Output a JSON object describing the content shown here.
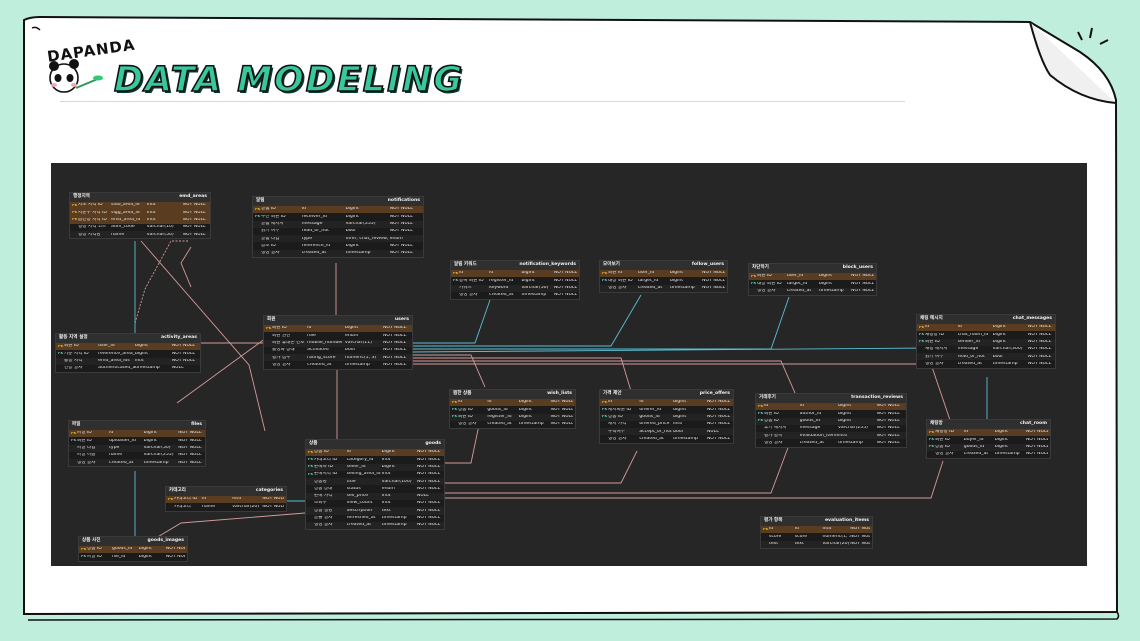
{
  "logo": {
    "text": "DAPANDA"
  },
  "title": "DATA MODELING",
  "erd": {
    "tables": [
      {
        "id": "emd_areas",
        "label": "행정지역",
        "name": "emd_areas",
        "rows": [
          [
            "PK",
            "시도 지역 ID",
            "sido_area_id",
            "int4",
            "NOT NULL"
          ],
          [
            "PK",
            "시군구 지역 ID",
            "sigg_area_id",
            "int4",
            "NOT NULL"
          ],
          [
            "PK",
            "읍면동 지역 ID",
            "emd_area_id",
            "int4",
            "NOT NULL"
          ],
          [
            "",
            "행정 지역 코드",
            "adm_code",
            "varchar(10)",
            "NOT NULL"
          ],
          [
            "",
            "행정 지역명",
            "name",
            "varchar(50)",
            "NOT NULL"
          ]
        ]
      },
      {
        "id": "notifications",
        "label": "알림",
        "name": "notifications",
        "rows": [
          [
            "PK",
            "알림 ID",
            "id",
            "bigint",
            "NOT NULL"
          ],
          [
            "FK",
            "수신 회원 ID",
            "receiver_id",
            "bigint",
            "NOT NULL"
          ],
          [
            "",
            "알림 메시지",
            "message",
            "varchar(255)",
            "NOT NULL"
          ],
          [
            "",
            "읽기 여부",
            "read_or_not",
            "bool",
            "NOT NULL"
          ],
          [
            "",
            "알림 타입",
            "type",
            "offer, chat_review, wishlist",
            "enum"
          ],
          [
            "",
            "참조 ID",
            "reference_id",
            "bigint",
            "NOT NULL"
          ],
          [
            "",
            "생성 일자",
            "created_at",
            "timestamp",
            "NOT NULL"
          ]
        ]
      },
      {
        "id": "notification_keywords",
        "label": "알림 키워드",
        "name": "notification_keywords",
        "rows": [
          [
            "PK",
            "id",
            "id",
            "bigint",
            "NOT NULL"
          ],
          [
            "FK",
            "등록 회원 ID",
            "register_id",
            "bigint",
            "NOT NULL"
          ],
          [
            "",
            "키워드",
            "keyword",
            "varchar(50)",
            "NOT NULL"
          ],
          [
            "",
            "생성 일자",
            "created_at",
            "timestamp",
            "NOT NULL"
          ]
        ]
      },
      {
        "id": "follow_users",
        "label": "모아보기",
        "name": "follow_users",
        "rows": [
          [
            "PK",
            "회원 id",
            "user_id",
            "bigint",
            "NOT NULL"
          ],
          [
            "FK",
            "대상 회원 ID",
            "target_id",
            "bigint",
            "NOT NULL"
          ],
          [
            "",
            "생성 일자",
            "created_at",
            "timestamp",
            "NOT NULL"
          ]
        ]
      },
      {
        "id": "block_users",
        "label": "차단하기",
        "name": "block_users",
        "rows": [
          [
            "PK",
            "회원 ID",
            "user_id",
            "bigint",
            "NOT NULL"
          ],
          [
            "FK",
            "대상 회원 ID",
            "target_id",
            "bigint",
            "NOT NULL"
          ],
          [
            "",
            "생성 일자",
            "created_at",
            "timestamp",
            "NOT NULL"
          ]
        ]
      },
      {
        "id": "activity_areas",
        "label": "활동 지역 설정",
        "name": "activity_areas",
        "rows": [
          [
            "PK",
            "회원 ID",
            "user_id",
            "bigint",
            "NOT NULL"
          ],
          [
            "FK",
            "기준 지역 ID",
            "reference_area_id",
            "bigint",
            "NOT NULL"
          ],
          [
            "",
            "활동 지역",
            "emd_area_ids",
            "int4",
            "NOT NULL"
          ],
          [
            "",
            "인증 일자",
            "authenticated_at",
            "timestamp",
            "NULL"
          ]
        ]
      },
      {
        "id": "users",
        "label": "회원",
        "name": "users",
        "rows": [
          [
            "PK",
            "회원 ID",
            "id",
            "bigint",
            "NOT NULL"
          ],
          [
            "",
            "회원 권한",
            "role",
            "enum",
            "NOT NULL"
          ],
          [
            "",
            "회원 휴대폰 번호",
            "mobile_number",
            "varchar(11)",
            "NOT NULL"
          ],
          [
            "",
            "활성화 상태",
            "activated",
            "bool",
            "NOT NULL"
          ],
          [
            "",
            "평가 점수",
            "rating_score",
            "numeric(1, 3)",
            "NOT NULL"
          ],
          [
            "",
            "생성 일자",
            "created_at",
            "timestamp",
            "NOT NULL"
          ]
        ]
      },
      {
        "id": "chat_messages",
        "label": "채팅 메시지",
        "name": "chat_messages",
        "rows": [
          [
            "PK",
            "id",
            "id",
            "bigint",
            "NOT NULL"
          ],
          [
            "FK",
            "채팅방 ID",
            "chat_room_id",
            "bigint",
            "NOT NULL"
          ],
          [
            "FK",
            "회원 ID",
            "sender_id",
            "bigint",
            "NOT NULL"
          ],
          [
            "",
            "채팅 메시지",
            "message",
            "varchar(300)",
            "NOT NULL"
          ],
          [
            "",
            "읽기 여부",
            "read_or_not",
            "bool",
            "NOT NULL"
          ],
          [
            "",
            "생성 일자",
            "created_at",
            "timestamp",
            "NOT NULL"
          ]
        ]
      },
      {
        "id": "wish_lists",
        "label": "찜한 상품",
        "name": "wish_lists",
        "rows": [
          [
            "PK",
            "id",
            "id",
            "bigint",
            "NOT NULL"
          ],
          [
            "FK",
            "상품 ID",
            "goods_id",
            "bigint",
            "NOT NULL"
          ],
          [
            "FK",
            "회원 ID",
            "register_id",
            "bigint",
            "NOT NULL"
          ],
          [
            "",
            "생성 일자",
            "created_at",
            "timestamp",
            "NOT NULL"
          ]
        ]
      },
      {
        "id": "price_offers",
        "label": "가격 제안",
        "name": "price_offers",
        "rows": [
          [
            "PK",
            "id",
            "id",
            "bigint",
            "NOT NULL"
          ],
          [
            "FK",
            "제시회원 ID",
            "offerer_id",
            "bigint",
            "NOT NULL"
          ],
          [
            "FK",
            "상품 ID",
            "goods_id",
            "bigint",
            "NOT NULL"
          ],
          [
            "",
            "제시 가격",
            "offered_price",
            "int4",
            "NOT NULL"
          ],
          [
            "",
            "수락여부",
            "accept_or_not",
            "bool",
            "NULL"
          ],
          [
            "",
            "생성 일자",
            "created_at",
            "timestamp",
            "NOT NULL"
          ]
        ]
      },
      {
        "id": "transaction_reviews",
        "label": "거래후기",
        "name": "transaction_reviews",
        "rows": [
          [
            "PK",
            "id",
            "id",
            "bigint",
            "NOT NULL"
          ],
          [
            "FK",
            "회원 ID",
            "author_id",
            "bigint",
            "NOT NULL"
          ],
          [
            "FK",
            "상품 ID",
            "goods_id",
            "bigint",
            "NOT NULL"
          ],
          [
            "",
            "후기 메시지",
            "message",
            "varchar(255)",
            "NOT NULL"
          ],
          [
            "",
            "평가 항목",
            "evaluation_items",
            "int4",
            "NOT NULL"
          ],
          [
            "",
            "생성 일자",
            "created_at",
            "timestamp",
            "NOT NULL"
          ]
        ]
      },
      {
        "id": "files",
        "label": "파일",
        "name": "files",
        "rows": [
          [
            "PK",
            "파일 ID",
            "id",
            "bigint",
            "NOT NULL"
          ],
          [
            "FK",
            "회원 ID",
            "uploader_id",
            "bigint",
            "NOT NULL"
          ],
          [
            "",
            "파일 타입",
            "type",
            "varchar(50)",
            "NOT NULL"
          ],
          [
            "",
            "파일 이름",
            "name",
            "varchar(255)",
            "NOT NULL"
          ],
          [
            "",
            "생성 일자",
            "created_at",
            "timestamp",
            "NOT NULL"
          ]
        ]
      },
      {
        "id": "chat_room",
        "label": "채팅방",
        "name": "chat_room",
        "rows": [
          [
            "PK",
            "채팅방 ID",
            "id",
            "bigint",
            "NOT NULL"
          ],
          [
            "FK",
            "회원 ID",
            "buyer_id",
            "bigint",
            "NOT NULL"
          ],
          [
            "FK",
            "상품 ID",
            "goods_id",
            "bigint",
            "NOT NULL"
          ],
          [
            "",
            "생성 일자",
            "created_at",
            "timestamp",
            "NOT NULL"
          ]
        ]
      },
      {
        "id": "goods",
        "label": "상품",
        "name": "goods",
        "rows": [
          [
            "PK",
            "상품 ID",
            "id",
            "bigint",
            "NOT NULL"
          ],
          [
            "FK",
            "카테고리 ID",
            "category_id",
            "int4",
            "NOT NULL"
          ],
          [
            "FK",
            "판매자 ID",
            "seller_id",
            "bigint",
            "NOT NULL"
          ],
          [
            "FK",
            "판매지역 ID",
            "selling_area_id",
            "int4",
            "NOT NULL"
          ],
          [
            "",
            "상품명",
            "title",
            "varchar(100)",
            "NOT NULL"
          ],
          [
            "",
            "상품 상태",
            "status",
            "enum",
            "NOT NULL"
          ],
          [
            "",
            "판매 가격",
            "sell_price",
            "int4",
            "NULL"
          ],
          [
            "",
            "조회수",
            "view_count",
            "int4",
            "NOT NULL"
          ],
          [
            "",
            "상품 설명",
            "description",
            "text",
            "NOT NULL"
          ],
          [
            "",
            "끌올 일자",
            "refreshed_at",
            "timestamp",
            "NOT NULL"
          ],
          [
            "",
            "생성 일자",
            "created_at",
            "timestamp",
            "NOT NULL"
          ]
        ]
      },
      {
        "id": "categories",
        "label": "카테고리",
        "name": "categories",
        "rows": [
          [
            "PK",
            "카테고리 ID",
            "id",
            "int4",
            "NOT NULL"
          ],
          [
            "",
            "카테고리",
            "name",
            "varchar(20)",
            "NOT NULL"
          ]
        ]
      },
      {
        "id": "evaluation_items",
        "label": "평가 항목",
        "name": "evaluation_items",
        "rows": [
          [
            "PK",
            "id",
            "id",
            "int4",
            "NOT NULL"
          ],
          [
            "",
            "score",
            "score",
            "numeric(1, 3)",
            "NOT NULL"
          ],
          [
            "",
            "text",
            "text",
            "varchar(20)",
            "NOT NULL"
          ]
        ]
      },
      {
        "id": "goods_images",
        "label": "상품 사진",
        "name": "goods_images",
        "rows": [
          [
            "PK",
            "상품 ID",
            "goods_id",
            "bigint",
            "NOT NULL"
          ],
          [
            "FK",
            "파일 ID",
            "file_id",
            "bigint",
            "NOT NULL"
          ]
        ]
      }
    ]
  }
}
